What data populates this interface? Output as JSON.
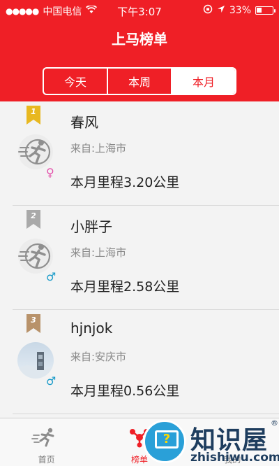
{
  "status_bar": {
    "carrier": "中国电信",
    "time": "下午3:07",
    "battery": "33%",
    "battery_level": 0.33
  },
  "header": {
    "title": "上马榜单",
    "tabs": [
      "今天",
      "本周",
      "本月"
    ],
    "active_tab": "本月"
  },
  "entries": [
    {
      "rank": "1",
      "name": "春风",
      "from": "来自:上海市",
      "mileage": "本月里程3.20公里",
      "gender_icon": "female-icon",
      "avatar": "runner-icon"
    },
    {
      "rank": "2",
      "name": "小胖子",
      "from": "来自:上海市",
      "mileage": "本月里程2.58公里",
      "gender_icon": "male-icon",
      "avatar": "runner-icon"
    },
    {
      "rank": "3",
      "name": "hjnjok",
      "from": "来自:安庆市",
      "mileage": "本月里程0.56公里",
      "gender_icon": "male-icon",
      "avatar": "photo"
    }
  ],
  "ribbon_colors": [
    "#e8b820",
    "#a9a9a9",
    "#b8926a"
  ],
  "bottom_nav": [
    {
      "label": "首页"
    },
    {
      "label": "榜单"
    },
    {
      "label": "我的"
    }
  ],
  "watermark": {
    "brand": "知识屋",
    "reg": "®",
    "url": "zhishiwu.com",
    "q": "?"
  },
  "colors": {
    "accent": "#ef1f26",
    "female": "#e34ea9",
    "male": "#1a9bc9"
  }
}
